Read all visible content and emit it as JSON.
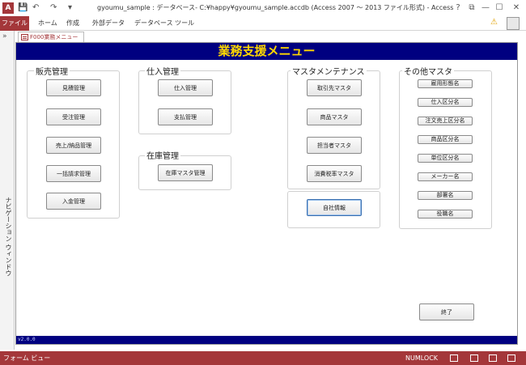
{
  "titlebar": {
    "app_logo": "A",
    "title": "gyoumu_sample : データベース- C:¥happy¥gyoumu_sample.accdb (Access 2007 ～ 2013 ファイル形式) - Access",
    "qat_icons": [
      "save-icon",
      "undo-icon",
      "redo-icon",
      "customize-icon"
    ],
    "window_buttons": [
      "?",
      "⧉",
      "—",
      "☐",
      "✕"
    ]
  },
  "ribbon": {
    "tabs": [
      "ファイル",
      "ホーム",
      "作成",
      "外部データ",
      "データベース ツール"
    ],
    "help_icon": "warning-icon"
  },
  "navpane": {
    "label": "ナビゲーション ウィンドウ",
    "toggle": "»"
  },
  "doc_tab": {
    "label": "F000業務メニュー"
  },
  "form": {
    "title": "業務支援メニュー",
    "version": "v2.0.0",
    "groups": {
      "sales": {
        "label": "販売管理",
        "buttons": [
          "見積管理",
          "受注管理",
          "売上/納品管理",
          "一括請求管理",
          "入金管理"
        ]
      },
      "purchase": {
        "label": "仕入管理",
        "buttons": [
          "仕入管理",
          "支払管理"
        ]
      },
      "inventory": {
        "label": "在庫管理",
        "buttons": [
          "在庫マスタ管理"
        ]
      },
      "master": {
        "label": "マスタメンテナンス",
        "buttons": [
          "取引先マスタ",
          "商品マスタ",
          "担当者マスタ",
          "消費税率マスタ"
        ]
      },
      "company": {
        "button": "自社情報"
      },
      "other": {
        "label": "その他マスタ",
        "buttons": [
          "雇用形態名",
          "仕入区分名",
          "注文売上区分名",
          "商品区分名",
          "単位区分名",
          "メーカー名",
          "部署名",
          "役職名"
        ]
      }
    },
    "exit_button": "終了"
  },
  "statusbar": {
    "view": "フォーム ビュー",
    "numlock": "NUMLOCK"
  },
  "colors": {
    "accent": "#a4373a",
    "form_header_bg": "#000080",
    "form_header_text": "#ffd700"
  }
}
